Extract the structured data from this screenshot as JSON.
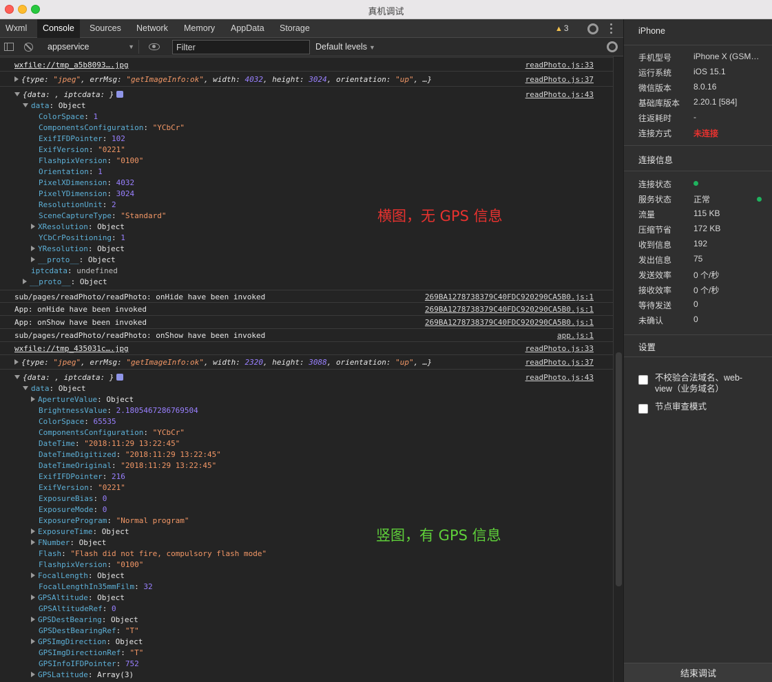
{
  "window": {
    "title": "真机调试"
  },
  "tabs": [
    "Wxml",
    "Console",
    "Sources",
    "Network",
    "Memory",
    "AppData",
    "Storage"
  ],
  "warnings_count": "3",
  "toolbar": {
    "context": "appservice",
    "filter_placeholder": "Filter",
    "levels": "Default levels"
  },
  "console": {
    "rows": [
      {
        "msg": "wxfile://tmp_a5b8093….jpg",
        "src": "readPhoto.js:33"
      },
      {
        "src": "readPhoto.js:37"
      },
      {
        "src": "readPhoto.js:43"
      },
      {
        "msg": "sub/pages/readPhoto/readPhoto: onHide have been invoked",
        "src": "269BA1278738379C40FDC920290CA5B0.js:1"
      },
      {
        "msg": "App: onHide have been invoked",
        "src": "269BA1278738379C40FDC920290CA5B0.js:1"
      },
      {
        "msg": "App: onShow have been invoked",
        "src": "269BA1278738379C40FDC920290CA5B0.js:1"
      },
      {
        "msg": "sub/pages/readPhoto/readPhoto: onShow have been invoked",
        "src": "app.js:1"
      },
      {
        "msg": "wxfile://tmp_435031c….jpg",
        "src": "readPhoto.js:33"
      },
      {
        "src": "readPhoto.js:37"
      },
      {
        "src": "readPhoto.js:43"
      }
    ],
    "info1": {
      "type": "jpeg",
      "errMsg": "getImageInfo:ok",
      "width": "4032",
      "height": "3024",
      "orientation": "up"
    },
    "info2": {
      "type": "jpeg",
      "errMsg": "getImageInfo:ok",
      "width": "2320",
      "height": "3088",
      "orientation": "up"
    },
    "tree1": [
      [
        "ColorSpace",
        "1",
        "n"
      ],
      [
        "ComponentsConfiguration",
        "\"YCbCr\"",
        "s"
      ],
      [
        "ExifIFDPointer",
        "102",
        "n"
      ],
      [
        "ExifVersion",
        "\"0221\"",
        "s"
      ],
      [
        "FlashpixVersion",
        "\"0100\"",
        "s"
      ],
      [
        "Orientation",
        "1",
        "n"
      ],
      [
        "PixelXDimension",
        "4032",
        "n"
      ],
      [
        "PixelYDimension",
        "3024",
        "n"
      ],
      [
        "ResolutionUnit",
        "2",
        "n"
      ],
      [
        "SceneCaptureType",
        "\"Standard\"",
        "s"
      ],
      [
        "XResolution",
        "Object",
        "o"
      ],
      [
        "YCbCrPositioning",
        "1",
        "n"
      ],
      [
        "YResolution",
        "Object",
        "o"
      ],
      [
        "__proto__",
        "Object",
        "o"
      ]
    ],
    "tree2": [
      [
        "ApertureValue",
        "Object",
        "o"
      ],
      [
        "BrightnessValue",
        "2.1805467286769504",
        "n"
      ],
      [
        "ColorSpace",
        "65535",
        "n"
      ],
      [
        "ComponentsConfiguration",
        "\"YCbCr\"",
        "s"
      ],
      [
        "DateTime",
        "\"2018:11:29 13:22:45\"",
        "s"
      ],
      [
        "DateTimeDigitized",
        "\"2018:11:29 13:22:45\"",
        "s"
      ],
      [
        "DateTimeOriginal",
        "\"2018:11:29 13:22:45\"",
        "s"
      ],
      [
        "ExifIFDPointer",
        "216",
        "n"
      ],
      [
        "ExifVersion",
        "\"0221\"",
        "s"
      ],
      [
        "ExposureBias",
        "0",
        "n"
      ],
      [
        "ExposureMode",
        "0",
        "n"
      ],
      [
        "ExposureProgram",
        "\"Normal program\"",
        "s"
      ],
      [
        "ExposureTime",
        "Object",
        "o"
      ],
      [
        "FNumber",
        "Object",
        "o"
      ],
      [
        "Flash",
        "\"Flash did not fire, compulsory flash mode\"",
        "s"
      ],
      [
        "FlashpixVersion",
        "\"0100\"",
        "s"
      ],
      [
        "FocalLength",
        "Object",
        "o"
      ],
      [
        "FocalLengthIn35mmFilm",
        "32",
        "n"
      ],
      [
        "GPSAltitude",
        "Object",
        "o"
      ],
      [
        "GPSAltitudeRef",
        "0",
        "n"
      ],
      [
        "GPSDestBearing",
        "Object",
        "o"
      ],
      [
        "GPSDestBearingRef",
        "\"T\"",
        "s"
      ],
      [
        "GPSImgDirection",
        "Object",
        "o"
      ],
      [
        "GPSImgDirectionRef",
        "\"T\"",
        "s"
      ],
      [
        "GPSInfoIFDPointer",
        "752",
        "n"
      ],
      [
        "GPSLatitude",
        "Array(3)",
        "o"
      ]
    ],
    "iptcdata_line": "undefined",
    "annotation1": "横图，无 GPS 信息",
    "annotation2": "竖图，有 GPS 信息",
    "annotation1_color": "#e8322f",
    "annotation2_color": "#5fd03a"
  },
  "right_panel": {
    "device_title": "iPhone",
    "device": [
      [
        "手机型号",
        "iPhone X (GSM…"
      ],
      [
        "运行系统",
        "iOS 15.1"
      ],
      [
        "微信版本",
        "8.0.16"
      ],
      [
        "基础库版本",
        "2.20.1 [584]"
      ],
      [
        "往返耗时",
        "-"
      ],
      [
        "连接方式",
        "未连接"
      ]
    ],
    "conn_title": "连接信息",
    "conn": [
      [
        "连接状态",
        ""
      ],
      [
        "服务状态",
        "正常"
      ],
      [
        "流量",
        "115 KB"
      ],
      [
        "压缩节省",
        "172 KB"
      ],
      [
        "收到信息",
        "192"
      ],
      [
        "发出信息",
        "75"
      ],
      [
        "发送效率",
        "0 个/秒"
      ],
      [
        "接收效率",
        "0 个/秒"
      ],
      [
        "等待发送",
        "0"
      ],
      [
        "未确认",
        "0"
      ]
    ],
    "settings_title": "设置",
    "check1": "不校验合法域名、web-view（业务域名）",
    "check2": "节点审查模式",
    "end_button": "结束调试",
    "status_color": "#1fb35e",
    "disconnected_color": "#e8322f"
  }
}
